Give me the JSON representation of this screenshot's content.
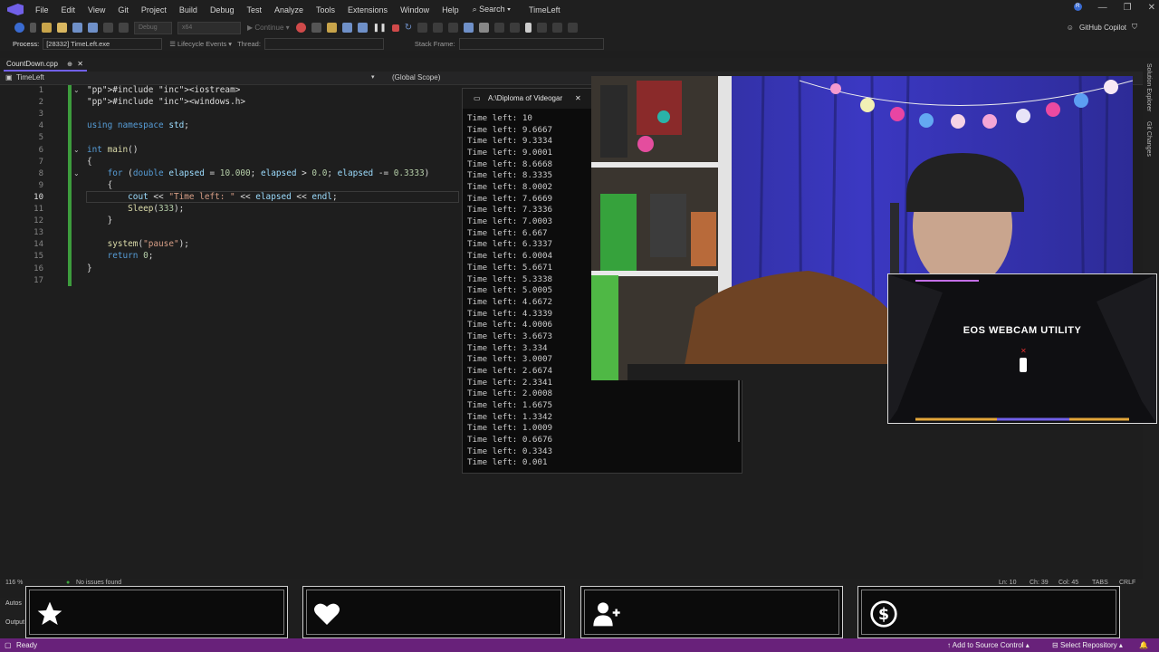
{
  "menu": {
    "items": [
      "File",
      "Edit",
      "View",
      "Git",
      "Project",
      "Build",
      "Debug",
      "Test",
      "Analyze",
      "Tools",
      "Extensions",
      "Window",
      "Help"
    ],
    "search_label": "Search",
    "solution_name": "TimeLeft",
    "avatar_initial": "R"
  },
  "toolbar": {
    "config": "Debug",
    "platform": "x64",
    "continue_label": "Continue",
    "copilot_label": "GitHub Copilot"
  },
  "process_bar": {
    "process_label": "Process:",
    "process_value": "[28332] TimeLeft.exe",
    "lifecycle_label": "Lifecycle Events",
    "thread_label": "Thread:",
    "stack_label": "Stack Frame:"
  },
  "editor": {
    "tab_name": "CountDown.cpp",
    "project_nav": "TimeLeft",
    "scope_nav": "(Global Scope)",
    "current_line": 10,
    "lines": [
      {
        "n": "1",
        "text": "#include <iostream>"
      },
      {
        "n": "2",
        "text": "#include <windows.h>"
      },
      {
        "n": "3",
        "text": ""
      },
      {
        "n": "4",
        "text": "using namespace std;"
      },
      {
        "n": "5",
        "text": ""
      },
      {
        "n": "6",
        "text": "int main()"
      },
      {
        "n": "7",
        "text": "{"
      },
      {
        "n": "8",
        "text": "    for (double elapsed = 10.000; elapsed > 0.0; elapsed -= 0.3333)"
      },
      {
        "n": "9",
        "text": "    {"
      },
      {
        "n": "10",
        "text": "        cout << \"Time left: \" << elapsed << endl;"
      },
      {
        "n": "11",
        "text": "        Sleep(333);"
      },
      {
        "n": "12",
        "text": "    }"
      },
      {
        "n": "13",
        "text": ""
      },
      {
        "n": "14",
        "text": "    system(\"pause\");"
      },
      {
        "n": "15",
        "text": "    return 0;"
      },
      {
        "n": "16",
        "text": "}"
      },
      {
        "n": "17",
        "text": ""
      }
    ]
  },
  "console": {
    "title": "A:\\Diploma of Videogar",
    "lines": [
      "Time left: 10",
      "Time left: 9.6667",
      "Time left: 9.3334",
      "Time left: 9.0001",
      "Time left: 8.6668",
      "Time left: 8.3335",
      "Time left: 8.0002",
      "Time left: 7.6669",
      "Time left: 7.3336",
      "Time left: 7.0003",
      "Time left: 6.667",
      "Time left: 6.3337",
      "Time left: 6.0004",
      "Time left: 5.6671",
      "Time left: 5.3338",
      "Time left: 5.0005",
      "Time left: 4.6672",
      "Time left: 4.3339",
      "Time left: 4.0006",
      "Time left: 3.6673",
      "Time left: 3.334",
      "Time left: 3.0007",
      "Time left: 2.6674",
      "Time left: 2.3341",
      "Time left: 2.0008",
      "Time left: 1.6675",
      "Time left: 1.3342",
      "Time left: 1.0009",
      "Time left: 0.6676",
      "Time left: 0.3343",
      "Time left: 0.001"
    ]
  },
  "eos": {
    "title": "EOS WEBCAM UTILITY"
  },
  "editor_status": {
    "zoom": "116 %",
    "issues": "No issues found",
    "ln": "Ln: 10",
    "ch": "Ch: 39",
    "col": "Col: 45",
    "tabs": "TABS",
    "eol": "CRLF"
  },
  "panels": {
    "autos_label": "Autos",
    "output_label": "Output"
  },
  "statusbar": {
    "ready": "Ready",
    "add_source": "Add to Source Control",
    "select_repo": "Select Repository"
  },
  "colors": {
    "accent": "#7160e8",
    "statusbar": "#68217a",
    "gutter_green": "#3d9c3d"
  },
  "icons": [
    "star-icon",
    "heart-icon",
    "add-user-icon",
    "dollar-icon"
  ]
}
